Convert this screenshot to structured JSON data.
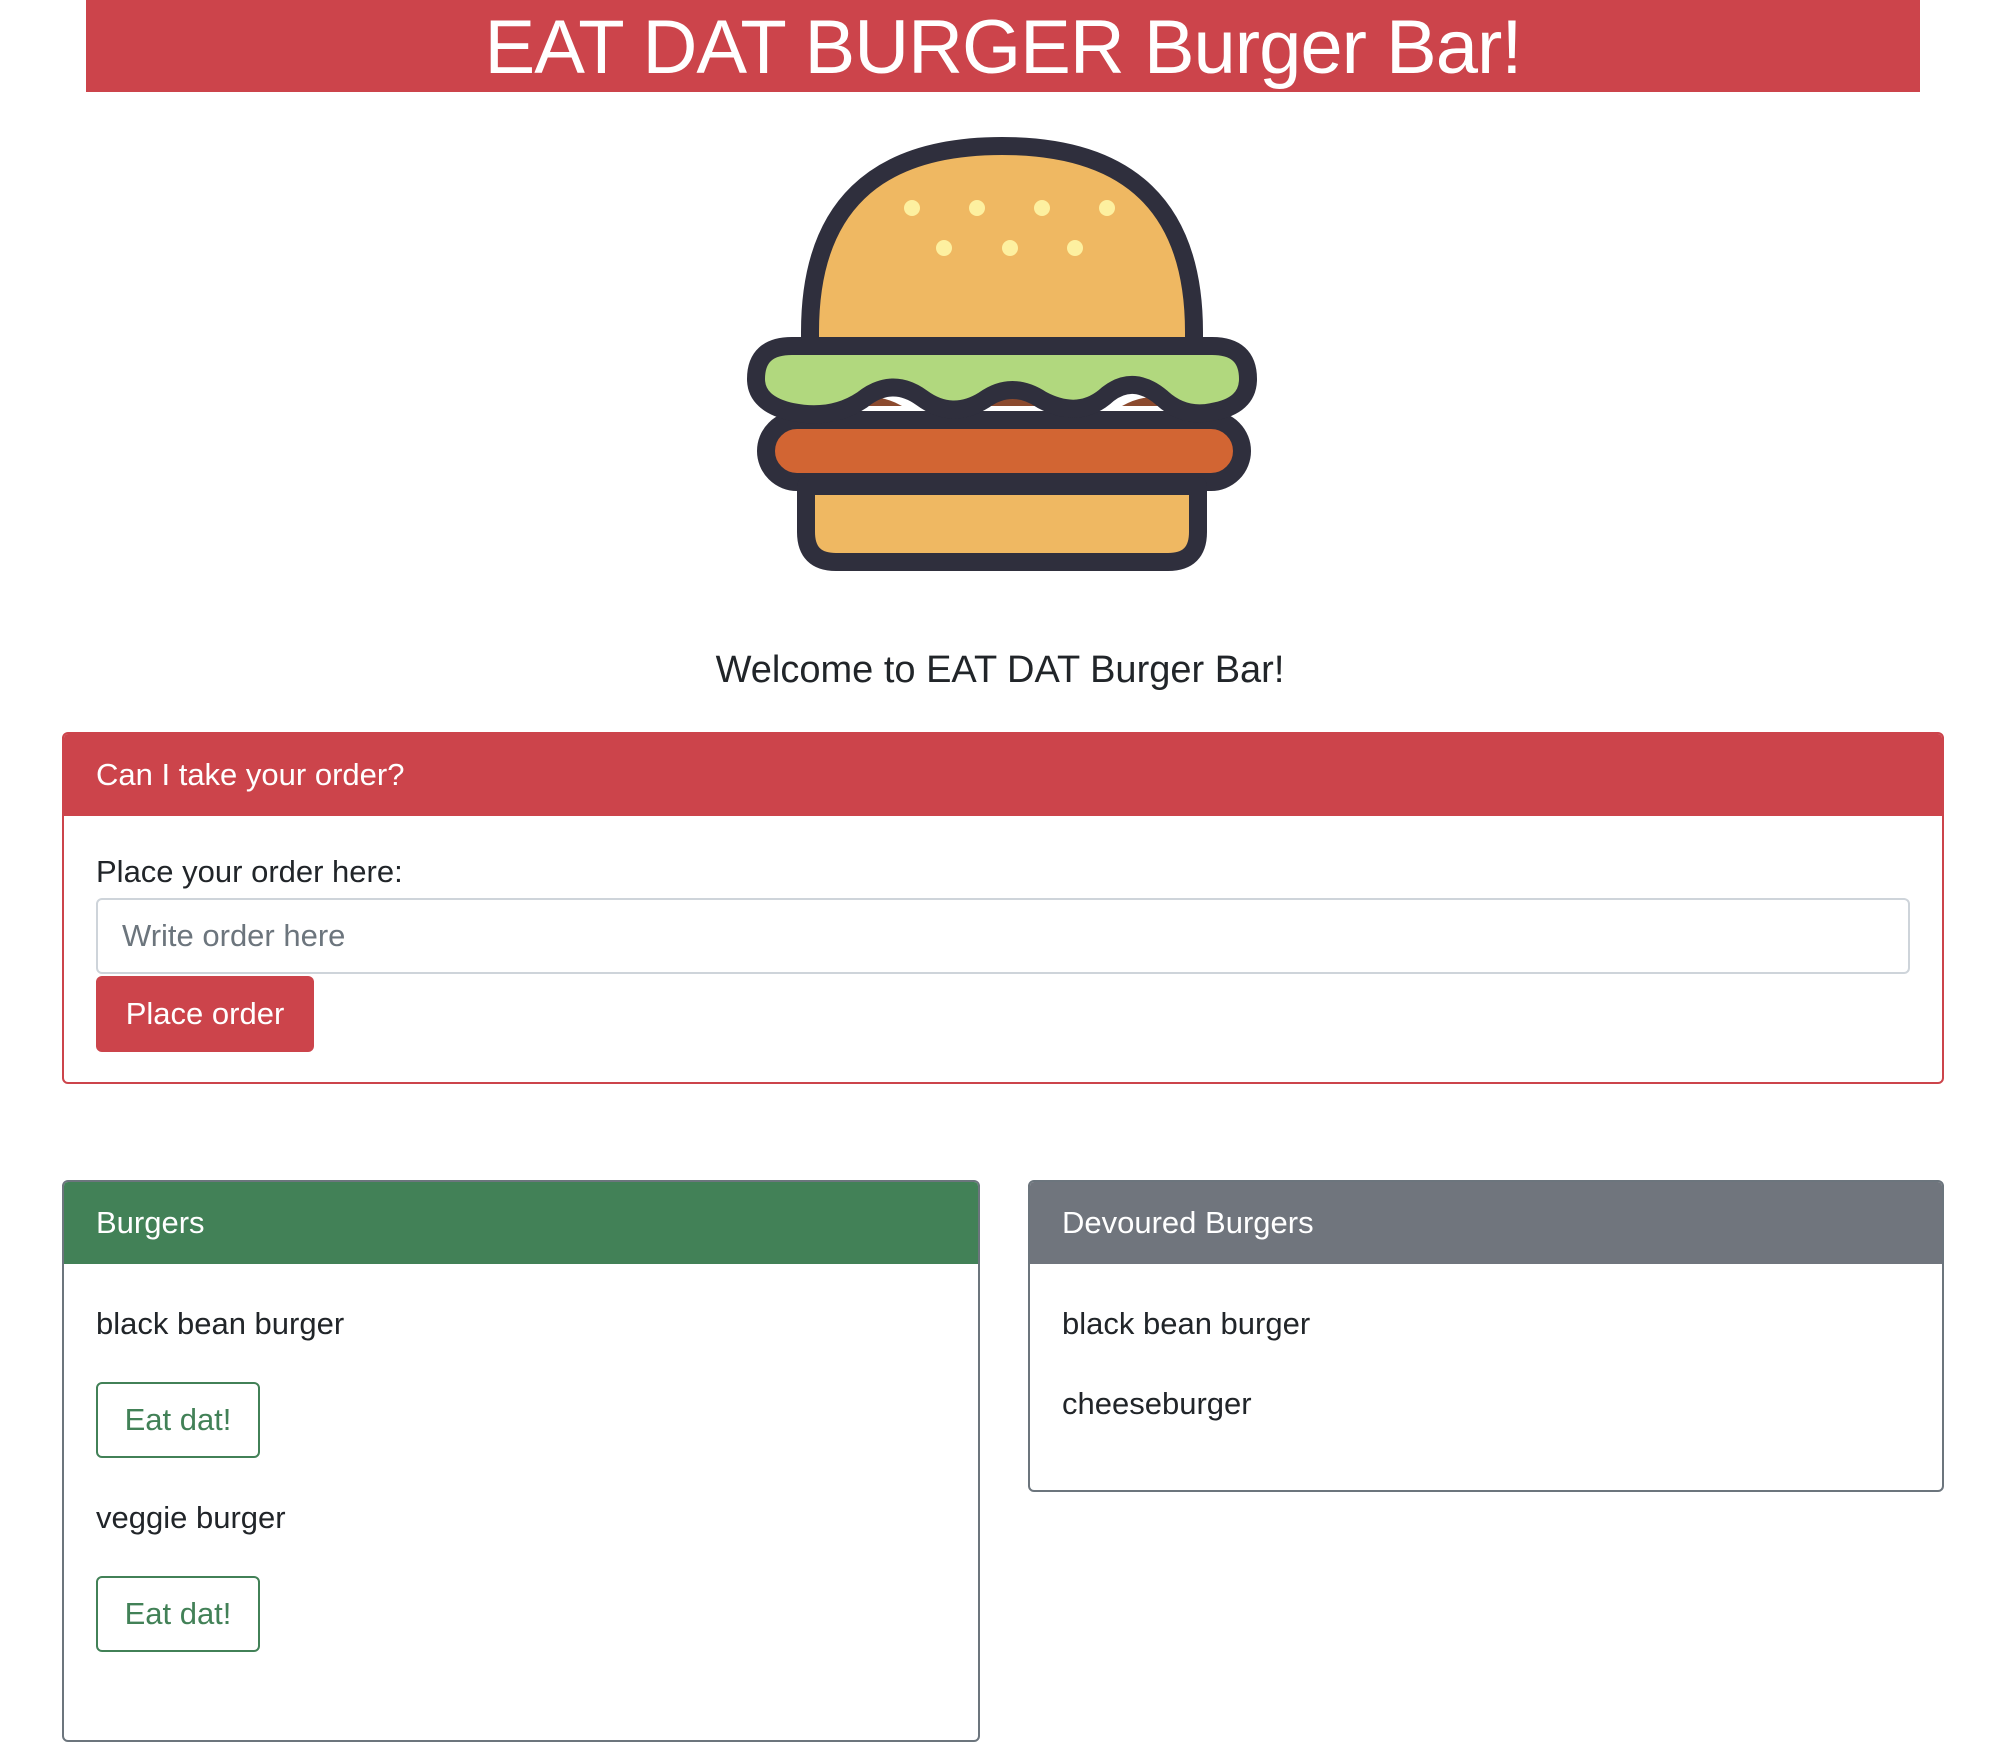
{
  "header": {
    "title": "EAT DAT BURGER Burger Bar!",
    "background": "#cc444b"
  },
  "logo": {
    "icon": "burger-icon"
  },
  "welcome": {
    "text": "Welcome to EAT DAT Burger Bar!"
  },
  "order_card": {
    "header": "Can I take your order?",
    "label": "Place your order here:",
    "input_value": "",
    "input_placeholder": "Write order here",
    "button_label": "Place order",
    "accent": "#cc444b"
  },
  "burgers_card": {
    "header": "Burgers",
    "accent": "#428157",
    "items": [
      {
        "name": "black bean burger",
        "button_label": "Eat dat!"
      },
      {
        "name": "veggie burger",
        "button_label": "Eat dat!"
      }
    ]
  },
  "devoured_card": {
    "header": "Devoured Burgers",
    "accent": "#70757d",
    "items": [
      {
        "name": "black bean burger"
      },
      {
        "name": "cheeseburger"
      }
    ]
  }
}
